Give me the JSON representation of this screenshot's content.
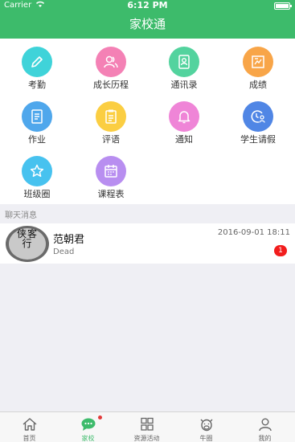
{
  "status_bar": {
    "carrier": "Carrier",
    "wifi_icon": "wifi-icon",
    "time": "6:12 PM",
    "battery_icon": "battery-icon"
  },
  "header": {
    "title": "家校通"
  },
  "grid": {
    "items": [
      {
        "label": "考勤",
        "icon": "pencil-icon",
        "color": "#3fd3d9"
      },
      {
        "label": "成长历程",
        "icon": "people-icon",
        "color": "#f481b5"
      },
      {
        "label": "通讯录",
        "icon": "contacts-icon",
        "color": "#53d39e"
      },
      {
        "label": "成绩",
        "icon": "report-icon",
        "color": "#f8a548"
      },
      {
        "label": "作业",
        "icon": "document-icon",
        "color": "#4fa7ec"
      },
      {
        "label": "评语",
        "icon": "clipboard-icon",
        "color": "#fbce42"
      },
      {
        "label": "通知",
        "icon": "bell-icon",
        "color": "#ef85d7"
      },
      {
        "label": "学生请假",
        "icon": "clock-person-icon",
        "color": "#5086e5"
      },
      {
        "label": "班级圈",
        "icon": "star-icon",
        "color": "#47c2ef"
      },
      {
        "label": "课程表",
        "icon": "calendar-icon",
        "color": "#b88ef0"
      }
    ]
  },
  "section": {
    "title": "聊天消息"
  },
  "chat": {
    "items": [
      {
        "name": "范朝君",
        "message": "Dead",
        "time": "2016-09-01 18:11",
        "badge": "1",
        "avatar_text": "侠客行"
      }
    ]
  },
  "tabbar": {
    "tabs": [
      {
        "label": "首页",
        "icon": "home-icon"
      },
      {
        "label": "家校",
        "icon": "chat-bubble-icon",
        "active": true
      },
      {
        "label": "资源活动",
        "icon": "apps-icon"
      },
      {
        "label": "牛圈",
        "icon": "cow-icon"
      },
      {
        "label": "我的",
        "icon": "person-icon"
      }
    ],
    "active_color": "#3dbb6b"
  }
}
